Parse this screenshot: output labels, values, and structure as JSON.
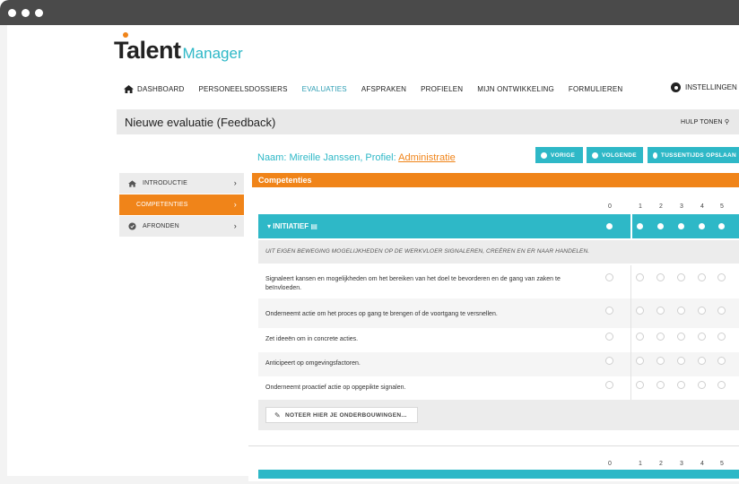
{
  "window": {
    "dots": 3
  },
  "logo": {
    "brand": "Talent",
    "suffix": "Manager"
  },
  "nav": {
    "items": [
      "DASHBOARD",
      "PERSONEELSDOSSIERS",
      "EVALUATIES",
      "AFSPRAKEN",
      "PROFIELEN",
      "MIJN ONTWIKKELING",
      "FORMULIEREN"
    ],
    "active": "EVALUATIES",
    "settings": "INSTELLINGEN"
  },
  "header": {
    "title": "Nieuwe evaluatie (Feedback)",
    "help": "HULP TONEN"
  },
  "person": {
    "name_prefix": "Naam: Mireille Janssen, Profiel: ",
    "profile_link": "Administratie"
  },
  "toolbar": {
    "prev": "VORIGE",
    "next": "VOLGENDE",
    "save": "TUSSENTIJDS OPSLAAN"
  },
  "sidebar": {
    "items": [
      {
        "label": "INTRODUCTIE",
        "icon": "home-icon"
      },
      {
        "label": "COMPETENTIES",
        "icon": null,
        "active": true
      },
      {
        "label": "AFRONDEN",
        "icon": "circle-check-icon"
      }
    ]
  },
  "section": {
    "title": "Competenties"
  },
  "scale": [
    "0",
    "1",
    "2",
    "3",
    "4",
    "5"
  ],
  "competence": {
    "title": "INITIATIEF",
    "description": "UIT EIGEN BEWEGING MOGELIJKHEDEN OP DE WERKVLOER SIGNALEREN, CREËREN EN ER NAAR HANDELEN.",
    "questions": [
      "Signaleert kansen en mogelijkheden om het bereiken van het doel te bevorderen en de gang van zaken te beïnvloeden.",
      "Onderneemt actie om het proces op gang te brengen of de voortgang te versnellen.",
      "Zet ideeën om in concrete acties.",
      "Anticipeert op omgevingsfactoren.",
      "Onderneemt proactief actie op opgepikte signalen."
    ],
    "note_button": "NOTEER HIER JE ONDERBOUWINGEN..."
  },
  "colors": {
    "accent": "#2eb8c7",
    "orange": "#f08419",
    "titlebar": "#4a4a4a"
  }
}
